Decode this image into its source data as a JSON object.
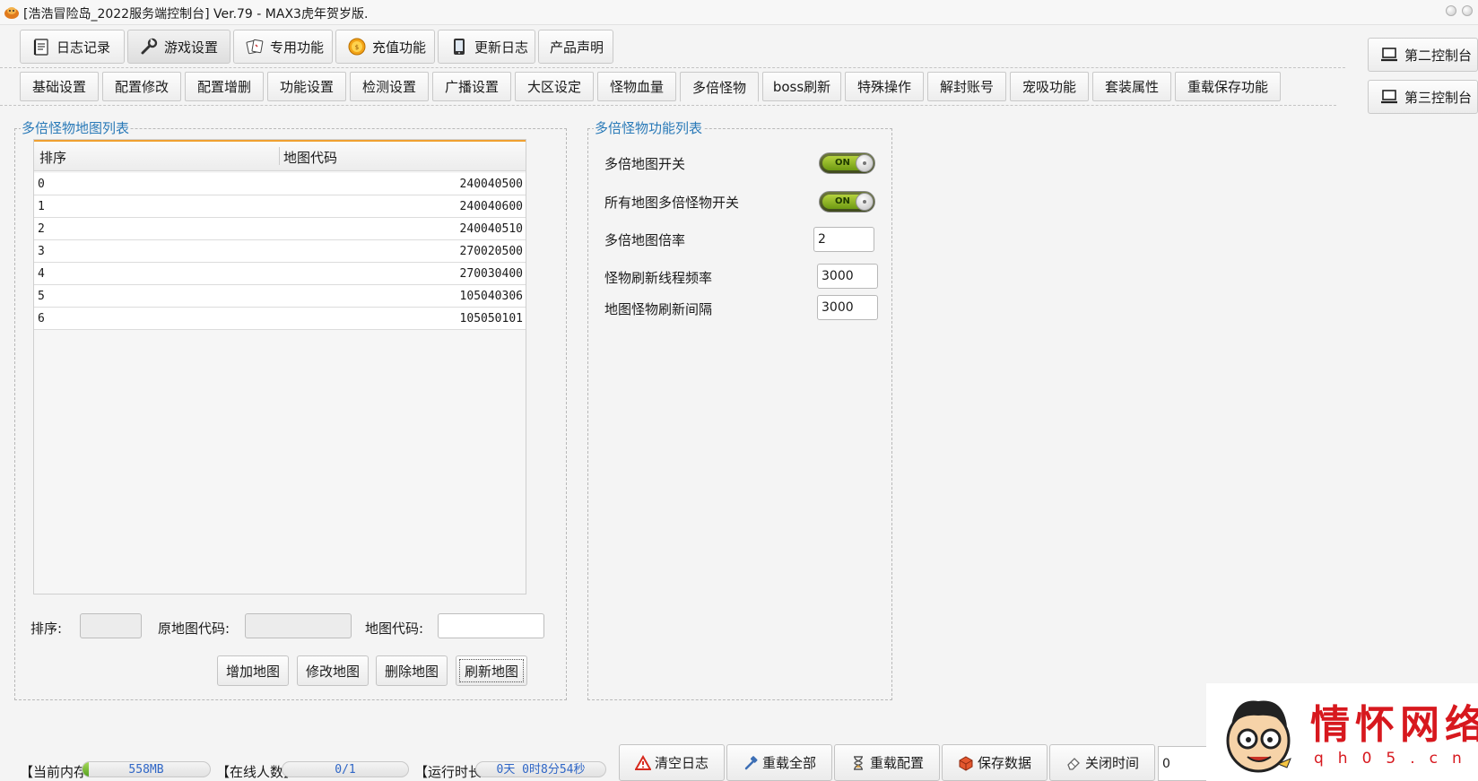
{
  "window": {
    "title": "[浩浩冒险岛_2022服务端控制台] Ver.79 - MAX3虎年贺岁版."
  },
  "top_tabs": [
    {
      "label": "日志记录",
      "icon": "notebook-icon"
    },
    {
      "label": "游戏设置",
      "icon": "wrench-icon",
      "active": true
    },
    {
      "label": "专用功能",
      "icon": "cards-icon"
    },
    {
      "label": "充值功能",
      "icon": "coin-icon"
    },
    {
      "label": "更新日志",
      "icon": "tablet-icon"
    },
    {
      "label": "产品声明",
      "icon": ""
    }
  ],
  "right_buttons": [
    {
      "label": "第二控制台",
      "icon": "laptop-icon"
    },
    {
      "label": "第三控制台",
      "icon": "laptop-icon"
    }
  ],
  "sub_tabs": [
    "基础设置",
    "配置修改",
    "配置增删",
    "功能设置",
    "检测设置",
    "广播设置",
    "大区设定",
    "怪物血量",
    "多倍怪物",
    "boss刷新",
    "特殊操作",
    "解封账号",
    "宠吸功能",
    "套装属性",
    "重载保存功能"
  ],
  "active_sub_tab": "多倍怪物",
  "map_list": {
    "title": "多倍怪物地图列表",
    "columns": [
      "排序",
      "地图代码"
    ],
    "rows": [
      {
        "order": "0",
        "code": "240040500"
      },
      {
        "order": "1",
        "code": "240040600"
      },
      {
        "order": "2",
        "code": "240040510"
      },
      {
        "order": "3",
        "code": "270020500"
      },
      {
        "order": "4",
        "code": "270030400"
      },
      {
        "order": "5",
        "code": "105040306"
      },
      {
        "order": "6",
        "code": "105050101"
      }
    ],
    "order_label": "排序:",
    "orig_code_label": "原地图代码:",
    "code_label": "地图代码:",
    "order_value": "",
    "orig_code_value": "",
    "code_value": "",
    "buttons": [
      "增加地图",
      "修改地图",
      "删除地图",
      "刷新地图"
    ]
  },
  "features": {
    "title": "多倍怪物功能列表",
    "switch_map": {
      "label": "多倍地图开关",
      "state": "ON"
    },
    "switch_all": {
      "label": "所有地图多倍怪物开关",
      "state": "ON"
    },
    "rate": {
      "label": "多倍地图倍率",
      "value": "2"
    },
    "thread_freq": {
      "label": "怪物刷新线程频率",
      "value": "3000"
    },
    "refresh_interval": {
      "label": "地图怪物刷新间隔",
      "value": "3000"
    }
  },
  "status": {
    "memory_label": "【当前内存",
    "memory_value": "558MB",
    "memory_fill": 0.05,
    "online_label": "【在线人数】",
    "online_value": "0/1",
    "online_fill": 0,
    "runtime_label": "【运行时长",
    "runtime_value": "0天 0时8分54秒",
    "runtime_fill": 0
  },
  "actions": [
    {
      "label": "清空日志",
      "icon": "warning-icon"
    },
    {
      "label": "重载全部",
      "icon": "hammer-icon"
    },
    {
      "label": "重载配置",
      "icon": "hourglass-icon"
    },
    {
      "label": "保存数据",
      "icon": "box-icon"
    },
    {
      "label": "关闭时间",
      "icon": "eraser-icon"
    }
  ],
  "tail_input_value": "0",
  "watermark": {
    "text": "情怀网络",
    "url": "qh05.cn"
  },
  "colors": {
    "accent_blue": "#2a7ab8",
    "toggle_green": "#8fbf1e",
    "header_orange": "#f0a030",
    "logo_red": "#d7181e"
  }
}
